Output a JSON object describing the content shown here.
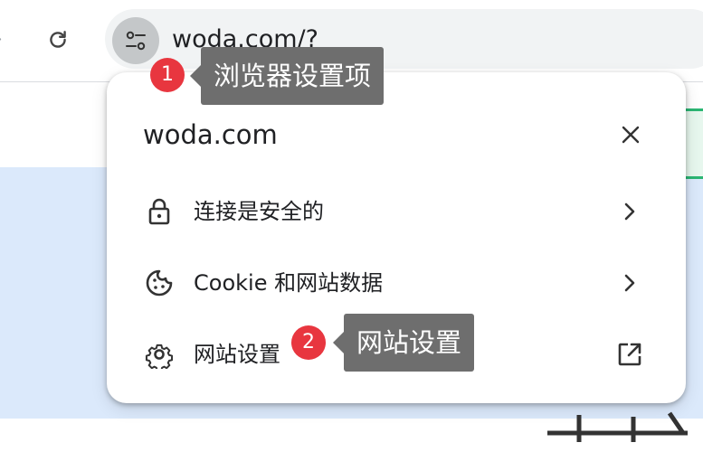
{
  "toolbar": {
    "url": "woda.com/?"
  },
  "popup": {
    "title": "woda.com",
    "rows": [
      {
        "label": "连接是安全的"
      },
      {
        "label": "Cookie 和网站数据"
      },
      {
        "label": "网站设置"
      }
    ]
  },
  "annotations": [
    {
      "number": "1",
      "text": "浏览器设置项"
    },
    {
      "number": "2",
      "text": "网站设置"
    }
  ],
  "colors": {
    "badge": "#e8363f",
    "tooltip": "#6e6e6e",
    "page_blue": "#dbe9fb",
    "omnibox": "#f1f3f4"
  }
}
